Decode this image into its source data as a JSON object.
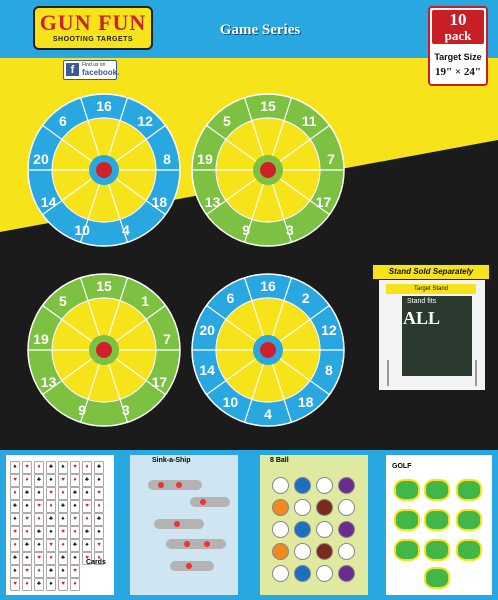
{
  "header": {
    "brand": "GUN FUN",
    "brand_sub": "SHOOTING TARGETS",
    "series_title": "Game Series",
    "facebook_find": "Find us on",
    "facebook_name": "facebook."
  },
  "pack": {
    "count": "10",
    "word": "pack",
    "size_label": "Target Size",
    "size": "19\" × 24\""
  },
  "stand": {
    "label": "Stand Sold Separately",
    "box_header": "Target Stand",
    "fits": "Stand fits",
    "all": "ALL"
  },
  "targets": [
    {
      "palette": "blue",
      "numbers": [
        "16",
        "12",
        "8",
        "18",
        "4",
        "10",
        "14",
        "20",
        "6"
      ]
    },
    {
      "palette": "green",
      "numbers": [
        "15",
        "11",
        "7",
        "17",
        "3",
        "9",
        "13",
        "19",
        "5"
      ]
    },
    {
      "palette": "green",
      "numbers": [
        "15",
        "1",
        "7",
        "17",
        "3",
        "9",
        "13",
        "19",
        "5"
      ]
    },
    {
      "palette": "blue",
      "numbers": [
        "16",
        "2",
        "12",
        "8",
        "18",
        "4",
        "10",
        "14",
        "20",
        "6"
      ]
    }
  ],
  "thumbnails": [
    {
      "title": "Cards"
    },
    {
      "title": "Sink-a-Ship"
    },
    {
      "title": "8 Ball"
    },
    {
      "title": "GOLF"
    }
  ],
  "colors": {
    "yellow": "#f6e31a",
    "blue": "#29a7e1",
    "green": "#7dc142",
    "red": "#d0202a",
    "black": "#1b1b1b"
  }
}
